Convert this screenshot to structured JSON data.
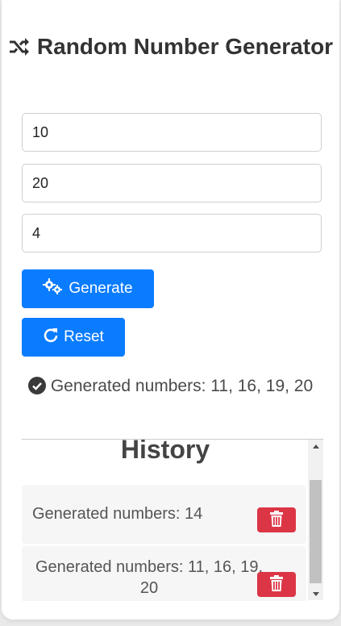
{
  "header": {
    "title": "Random Number Generator",
    "icon": "shuffle-icon"
  },
  "inputs": {
    "min_value": "10",
    "max_value": "20",
    "count_value": "4"
  },
  "buttons": {
    "generate_label": "Generate",
    "reset_label": "Reset"
  },
  "result": {
    "text": "Generated numbers: 11, 16, 19, 20"
  },
  "history": {
    "title": "History",
    "items": [
      {
        "text": "Generated numbers: 14"
      },
      {
        "text": "Generated numbers: 11, 16, 19, 20"
      }
    ]
  },
  "colors": {
    "primary": "#0a7cff",
    "danger": "#dc3545",
    "success": "#3a3a3a"
  }
}
